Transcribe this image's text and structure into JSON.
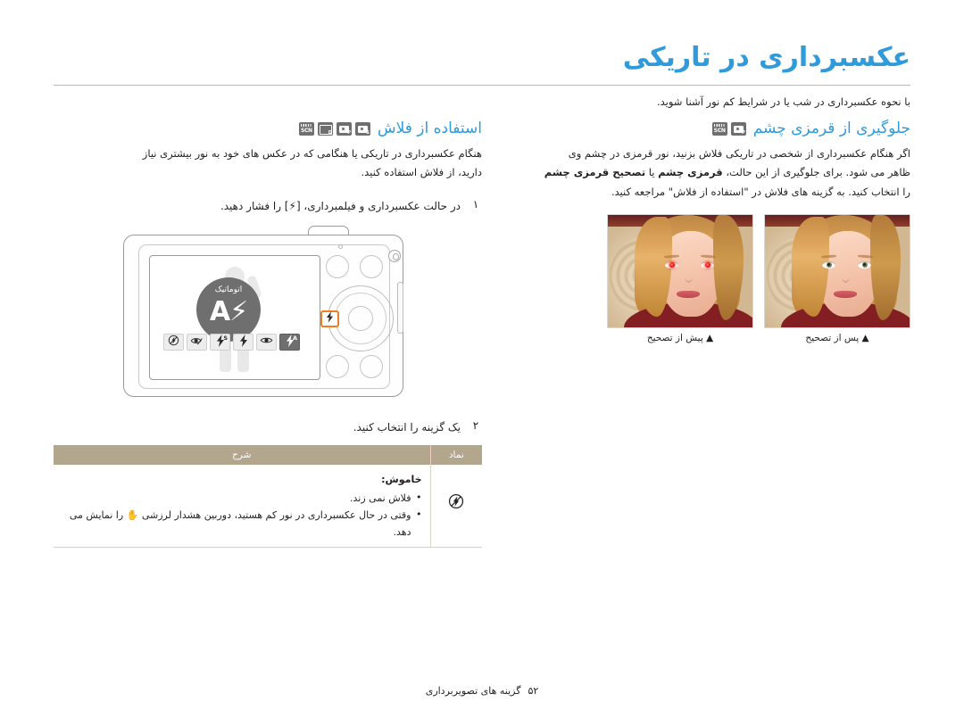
{
  "document": {
    "title": "عکسبرداری در تاریکی",
    "intro": "با نحوه عکسبرداری در شب یا در شرایط کم نور آشنا شوید.",
    "footer": {
      "page_number": "۵۲",
      "section": "گزینه های تصویربرداری"
    }
  },
  "right_section": {
    "heading": "جلوگیری از قرمزی چشم",
    "badges": [
      "program-mode-badge",
      "scene-mode-badge"
    ],
    "paragraph_1": "اگر هنگام عکسبرداری از شخصی در تاریکی فلاش بزنید، نور قرمزی در چشم وی",
    "paragraph_2_a": "ظاهر می شود. برای جلوگیری از این حالت، ",
    "paragraph_2_b": "قرمزی چشم",
    "paragraph_2_c": " یا ",
    "paragraph_2_d": "تصحیح قرمزی چشم",
    "paragraph_3": "را انتخاب کنید. به گزینه های فلاش در \"استفاده از فلاش\" مراجعه کنید.",
    "photos": [
      {
        "name": "after-correction-photo",
        "caption": "▲ پس از تصحیح",
        "state": "corrected"
      },
      {
        "name": "before-correction-photo",
        "caption": "▲ پیش از تصحیح",
        "state": "red-eye"
      }
    ]
  },
  "left_section": {
    "heading": "استفاده از فلاش",
    "badges": [
      "smart-auto-badge",
      "program-mode-badge",
      "dual-is-badge",
      "scene-mode-badge"
    ],
    "paragraph_1": "هنگام عکسبرداری در تاریکی یا هنگامی که در عکس های خود به نور بیشتری نیاز",
    "paragraph_2": "دارید، از فلاش استفاده کنید.",
    "steps": [
      {
        "number": "۱",
        "text_a": "در حالت عکسبرداری و فیلمبرداری، [",
        "key_glyph": "⚡",
        "text_b": "] را فشار دهید."
      },
      {
        "number": "۲",
        "text_a": "یک گزینه را انتخاب کنید.",
        "key_glyph": "",
        "text_b": ""
      }
    ],
    "camera": {
      "auto_bubble_label": "اتوماتیک",
      "auto_bubble_glyph": "⚡A",
      "highlight_key_glyph": "⚡",
      "flash_options": [
        {
          "name": "flash-off-option",
          "glyph": "⚡",
          "sup": "",
          "style": "off",
          "selected": false
        },
        {
          "name": "red-eye-fix-option",
          "glyph": "👁",
          "sup": "",
          "style": "eyefix",
          "selected": false
        },
        {
          "name": "slow-sync-option",
          "glyph": "⚡",
          "sup": "S",
          "style": "normal",
          "selected": false
        },
        {
          "name": "fill-in-flash-option",
          "glyph": "⚡",
          "sup": "",
          "style": "normal",
          "selected": false
        },
        {
          "name": "red-eye-option",
          "glyph": "👁",
          "sup": "",
          "style": "eye",
          "selected": false
        },
        {
          "name": "auto-flash-option",
          "glyph": "⚡",
          "sup": "A",
          "style": "normal",
          "selected": true
        }
      ]
    },
    "table": {
      "headers": {
        "icon": "نماد",
        "description": "شرح"
      },
      "rows": [
        {
          "icon_name": "flash-off-icon",
          "icon_glyph": "⚡",
          "option_title": "خاموش:",
          "bullets": [
            "فلاش نمی زند.",
            "وقتی در حال عکسبرداری در نور کم هستید، دوربین هشدار لرزشی ✋ را نمایش می دهد."
          ]
        }
      ]
    }
  },
  "colors": {
    "title": "#2f9bdb",
    "heading": "#2f9bdb",
    "table_header_bg": "#b2a68c",
    "highlight": "#f07d23",
    "body_text": "#231f20",
    "rule": "#b9b9b9"
  }
}
